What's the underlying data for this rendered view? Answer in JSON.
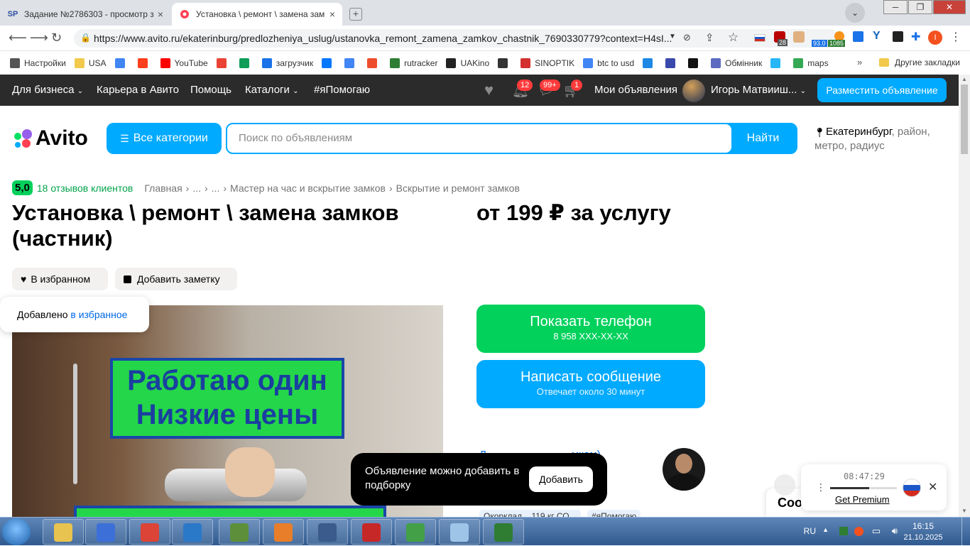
{
  "browser": {
    "tabs": [
      {
        "label": "Задание №2786303 - просмотр з",
        "favicon": "SP",
        "active": false
      },
      {
        "label": "Установка \\ ремонт \\ замена зам",
        "favicon": "avito-icon",
        "active": true
      }
    ],
    "url": "https://www.avito.ru/ekaterinburg/predlozheniya_uslug/ustanovka_remont_zamena_zamkov_chastnik_7690330779?context=H4sI...",
    "window_controls": [
      "minimize",
      "maximize",
      "close"
    ],
    "extension_badges": {
      "shield": "28",
      "weather": "93.0",
      "counter": "1085"
    },
    "profile_initial": "I",
    "bookmarks": [
      {
        "label": "Настройки",
        "icon": "gear-icon",
        "color": "#555555"
      },
      {
        "label": "USA",
        "icon": "folder-icon",
        "color": "#f2c94c"
      },
      {
        "label": "",
        "icon": "google-icon",
        "color": "#4285f4"
      },
      {
        "label": "",
        "icon": "yandex-icon",
        "color": "#fc3f1d"
      },
      {
        "label": "YouTube",
        "icon": "youtube-icon",
        "color": "#ff0000"
      },
      {
        "label": "",
        "icon": "gmail-icon",
        "color": "#ea4335"
      },
      {
        "label": "",
        "icon": "drive-icon",
        "color": "#0f9d58"
      },
      {
        "label": "загрузчик",
        "icon": "infinity-icon",
        "color": "#1a73e8"
      },
      {
        "label": "",
        "icon": "vk-icon",
        "color": "#0077ff"
      },
      {
        "label": "",
        "icon": "translate-icon",
        "color": "#4285f4"
      },
      {
        "label": "",
        "icon": "f-icon",
        "color": "#ee4d2d"
      },
      {
        "label": "rutracker",
        "icon": "rutracker-icon",
        "color": "#2e7d32"
      },
      {
        "label": "UAKino",
        "icon": "uakino-icon",
        "color": "#222222"
      },
      {
        "label": "",
        "icon": "chess-icon",
        "color": "#333333"
      },
      {
        "label": "SINOPTIK",
        "icon": "thermometer-icon",
        "color": "#d32f2f"
      },
      {
        "label": "btc to usd",
        "icon": "google-icon",
        "color": "#4285f4"
      },
      {
        "label": "",
        "icon": "p-icon",
        "color": "#1e88e5"
      },
      {
        "label": "",
        "icon": "arrow-icon",
        "color": "#3949ab"
      },
      {
        "label": "",
        "icon": "bc-icon",
        "color": "#111111"
      },
      {
        "label": "Обмінник",
        "icon": "exchange-icon",
        "color": "#5c6bc0"
      },
      {
        "label": "",
        "icon": "snow-icon",
        "color": "#29b6f6"
      },
      {
        "label": "maps",
        "icon": "maps-icon",
        "color": "#34a853"
      }
    ],
    "bookmarks_more": "»",
    "other_bookmarks": "Другие закладки"
  },
  "avito_nav": {
    "items": [
      "Для бизнеса",
      "Карьера в Авито",
      "Помощь",
      "Каталоги",
      "#яПомогаю"
    ],
    "notifications_badge": "12",
    "messages_badge": "99+",
    "cart_badge": "1",
    "my_ads": "Мои объявления",
    "user_name": "Игорь Матвииш...",
    "post_button": "Разместить объявление"
  },
  "header": {
    "logo": "Avito",
    "categories_button": "Все категории",
    "search_placeholder": "Поиск по объявлениям",
    "search_button": "Найти",
    "location_city": "Екатеринбург",
    "location_rest": ", район, метро, радиус"
  },
  "listing": {
    "rating": "5,0",
    "reviews": "18 отзывов клиентов",
    "breadcrumbs": [
      "Главная",
      "...",
      "...",
      "Мастер на час и вскрытие замков",
      "Вскрытие и ремонт замков"
    ],
    "title": "Установка \\ ремонт \\ замена замков (частник)",
    "price": "от 199 ₽ за услугу",
    "favorite_chip": "В избранном",
    "note_chip": "Добавить заметку",
    "photo_text_1": "Работаю один",
    "photo_text_2": "Низкие цены",
    "phone_button": "Показать телефон",
    "phone_masked": "8 958 XXX-XX-XX",
    "message_button": "Написать сообщение",
    "message_sub": "Отвечает около 30 минут",
    "seller_link_start": "Л",
    "seller_link_end": "мкам)",
    "tags": [
      "Окорклад... 119 кг СО...",
      "#яПомогаю"
    ]
  },
  "toasts": {
    "favorite_text": "Добавлено ",
    "favorite_link": "в избранное",
    "collection_text": "Объявление можно добавить в подборку",
    "collection_button": "Добавить",
    "chat_stub": "Coo"
  },
  "recorder": {
    "time": "08:47:29",
    "premium": "Get Premium",
    "progress": 0.58
  },
  "taskbar": {
    "lang": "RU",
    "time": "16:15",
    "date": "21.10.2025",
    "apps": [
      "explorer-icon",
      "shield-w-icon",
      "chrome-icon",
      "globe-icon",
      "monitor-icon",
      "media-icon",
      "clock-icon",
      "64-icon",
      "chart-icon",
      "notepad-icon",
      "terminal-icon"
    ]
  },
  "colors": {
    "avito_green": "#02d15c",
    "avito_blue": "#00aaff",
    "link_blue": "#0068e5",
    "dark_nav": "#2b2b2b"
  }
}
